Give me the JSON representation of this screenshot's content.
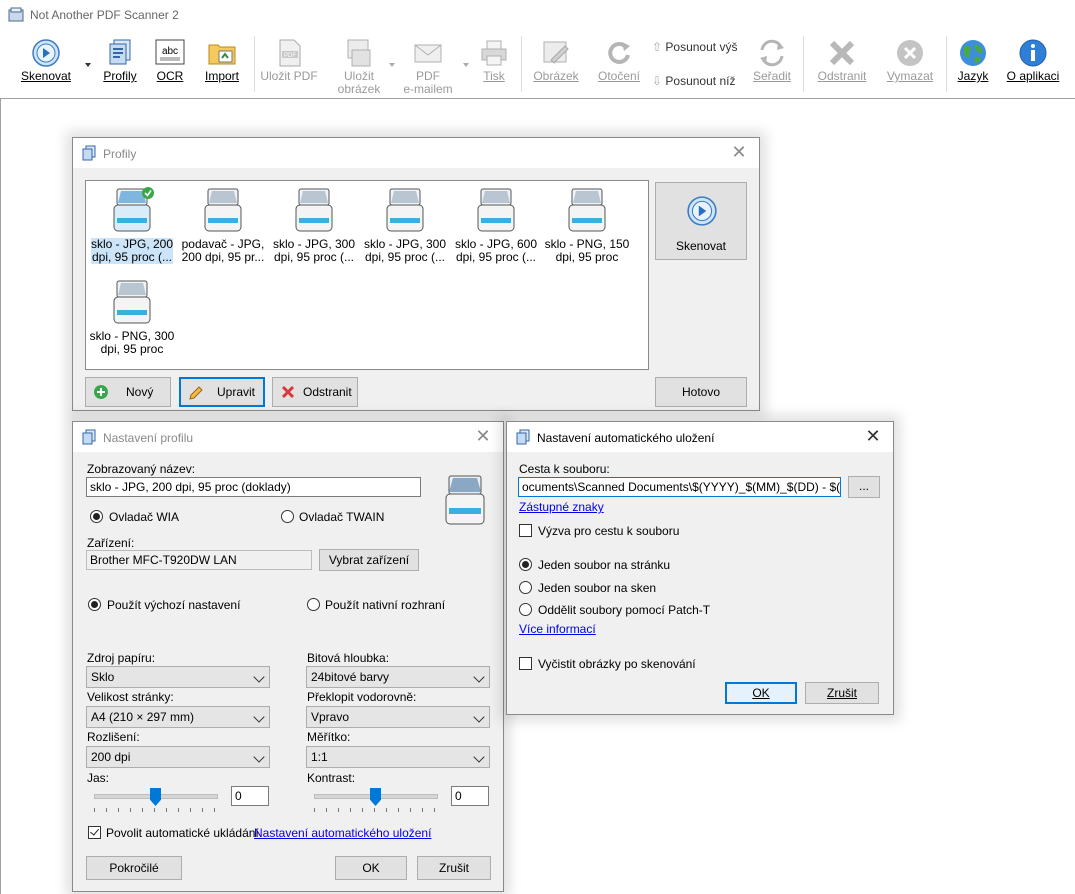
{
  "app": {
    "title": "Not Another PDF Scanner 2"
  },
  "toolbar": {
    "scan": "Skenovat",
    "profiles": "Profily",
    "ocr": "OCR",
    "import": "Import",
    "save_pdf": "Uložit PDF",
    "save_image_1": "Uložit",
    "save_image_2": "obrázek",
    "email_pdf_1": "PDF",
    "email_pdf_2": "e-mailem",
    "print": "Tisk",
    "image": "Obrázek",
    "rotate": "Otočení",
    "move_up": "Posunout výš",
    "move_down": "Posunout níž",
    "sort": "Seřadit",
    "delete": "Odstranit",
    "clear": "Vymazat",
    "language": "Jazyk",
    "about": "O aplikaci"
  },
  "profiles_dialog": {
    "title": "Profily",
    "items": [
      {
        "line1": "sklo - JPG, 200",
        "line2": "dpi, 95 proc (...",
        "selected": true,
        "default": true
      },
      {
        "line1": "podavač - JPG,",
        "line2": "200 dpi, 95 pr..."
      },
      {
        "line1": "sklo - JPG, 300",
        "line2": "dpi, 95 proc (..."
      },
      {
        "line1": "sklo - JPG, 300",
        "line2": "dpi, 95 proc (..."
      },
      {
        "line1": "sklo - JPG, 600",
        "line2": "dpi, 95 proc (..."
      },
      {
        "line1": "sklo - PNG, 150",
        "line2": "dpi, 95 proc"
      },
      {
        "line1": "sklo - PNG, 300",
        "line2": "dpi, 95 proc"
      }
    ],
    "scan_button": "Skenovat",
    "new_button": "Nový",
    "edit_button": "Upravit",
    "delete_button": "Odstranit",
    "done_button": "Hotovo"
  },
  "profile_settings": {
    "title": "Nastavení profilu",
    "display_name_label": "Zobrazovaný název:",
    "display_name_value": "sklo - JPG, 200 dpi, 95 proc (doklady)",
    "driver_wia": "Ovladač WIA",
    "driver_twain": "Ovladač TWAIN",
    "device_label": "Zařízení:",
    "device_value": "Brother MFC-T920DW LAN",
    "choose_device": "Vybrat zařízení",
    "use_default": "Použít výchozí nastavení",
    "use_native": "Použít nativní rozhraní",
    "paper_source_label": "Zdroj papíru:",
    "paper_source_value": "Sklo",
    "bit_depth_label": "Bitová hloubka:",
    "bit_depth_value": "24bitové barvy",
    "page_size_label": "Velikost stránky:",
    "page_size_value": "A4 (210 × 297 mm)",
    "flip_label": "Překlopit vodorovně:",
    "flip_value": "Vpravo",
    "resolution_label": "Rozlišení:",
    "resolution_value": "200 dpi",
    "scale_label": "Měřítko:",
    "scale_value": "1:1",
    "brightness_label": "Jas:",
    "brightness_value": "0",
    "contrast_label": "Kontrast:",
    "contrast_value": "0",
    "auto_save_label": "Povolit automatické ukládání",
    "auto_save_link": "Nastavení automatického uložení",
    "advanced_button": "Pokročilé",
    "ok_button": "OK",
    "cancel_button": "Zrušit"
  },
  "autosave_dialog": {
    "title": "Nastavení automatického uložení",
    "path_label": "Cesta k souboru:",
    "path_value": "ocuments\\Scanned Documents\\$(YYYY)_$(MM)_$(DD) - $(nn).jpg",
    "browse_button": "...",
    "placeholders_link": "Zástupné znaky",
    "prompt_label": "Výzva pro cestu k souboru",
    "one_per_page": "Jeden soubor na stránku",
    "one_per_scan": "Jeden soubor na sken",
    "patch_t": "Oddělit soubory pomocí Patch-T",
    "more_info_link": "Více informací",
    "clear_images": "Vyčistit obrázky po skenování",
    "ok_button": "OK",
    "cancel_button": "Zrušit"
  },
  "colors": {
    "accent": "#0078d7",
    "link": "#0000ee",
    "dialog_bg": "#f0f0f0"
  }
}
